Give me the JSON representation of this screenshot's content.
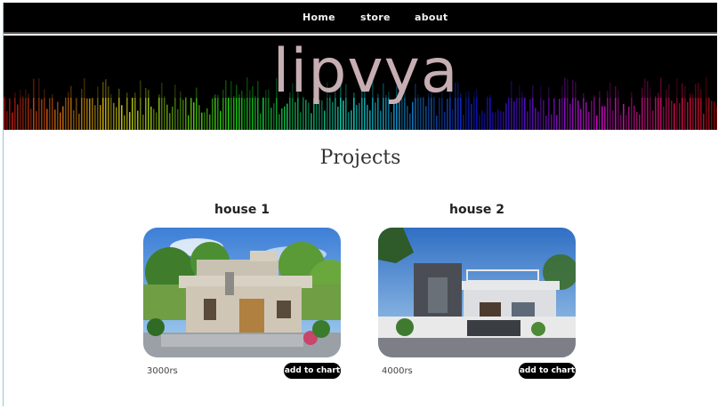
{
  "nav": {
    "items": [
      {
        "label": "Home"
      },
      {
        "label": "store"
      },
      {
        "label": "about"
      }
    ]
  },
  "banner": {
    "brand": "lipvya"
  },
  "main": {
    "title": "Projects",
    "cards": [
      {
        "title": "house 1",
        "price": "3000rs",
        "button": "add to chart"
      },
      {
        "title": "house 2",
        "price": "4000rs",
        "button": "add to chart"
      }
    ]
  },
  "colors": {
    "background": "#000000",
    "brand": "#c6aeb2",
    "button": "#000000"
  }
}
